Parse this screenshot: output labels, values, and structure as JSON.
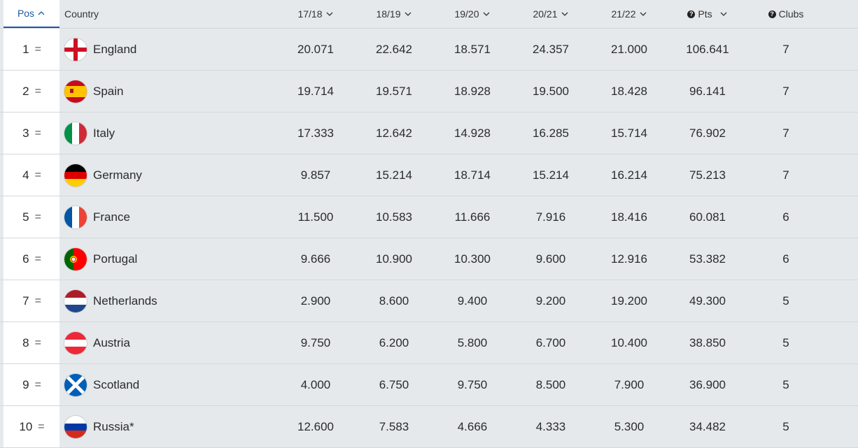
{
  "header": {
    "pos": "Pos",
    "country": "Country",
    "seasons": [
      "17/18",
      "18/19",
      "19/20",
      "20/21",
      "21/22"
    ],
    "pts": "Pts",
    "clubs": "Clubs"
  },
  "rows": [
    {
      "pos": "1",
      "trend": "=",
      "country": "England",
      "flag": "england-flag-icon",
      "s": [
        "20.071",
        "22.642",
        "18.571",
        "24.357",
        "21.000"
      ],
      "pts": "106.641",
      "clubs": "7"
    },
    {
      "pos": "2",
      "trend": "=",
      "country": "Spain",
      "flag": "spain-flag-icon",
      "s": [
        "19.714",
        "19.571",
        "18.928",
        "19.500",
        "18.428"
      ],
      "pts": "96.141",
      "clubs": "7"
    },
    {
      "pos": "3",
      "trend": "=",
      "country": "Italy",
      "flag": "italy-flag-icon",
      "s": [
        "17.333",
        "12.642",
        "14.928",
        "16.285",
        "15.714"
      ],
      "pts": "76.902",
      "clubs": "7"
    },
    {
      "pos": "4",
      "trend": "=",
      "country": "Germany",
      "flag": "germany-flag-icon",
      "s": [
        "9.857",
        "15.214",
        "18.714",
        "15.214",
        "16.214"
      ],
      "pts": "75.213",
      "clubs": "7"
    },
    {
      "pos": "5",
      "trend": "=",
      "country": "France",
      "flag": "france-flag-icon",
      "s": [
        "11.500",
        "10.583",
        "11.666",
        "7.916",
        "18.416"
      ],
      "pts": "60.081",
      "clubs": "6"
    },
    {
      "pos": "6",
      "trend": "=",
      "country": "Portugal",
      "flag": "portugal-flag-icon",
      "s": [
        "9.666",
        "10.900",
        "10.300",
        "9.600",
        "12.916"
      ],
      "pts": "53.382",
      "clubs": "6"
    },
    {
      "pos": "7",
      "trend": "=",
      "country": "Netherlands",
      "flag": "netherlands-flag-icon",
      "s": [
        "2.900",
        "8.600",
        "9.400",
        "9.200",
        "19.200"
      ],
      "pts": "49.300",
      "clubs": "5"
    },
    {
      "pos": "8",
      "trend": "=",
      "country": "Austria",
      "flag": "austria-flag-icon",
      "s": [
        "9.750",
        "6.200",
        "5.800",
        "6.700",
        "10.400"
      ],
      "pts": "38.850",
      "clubs": "5"
    },
    {
      "pos": "9",
      "trend": "=",
      "country": "Scotland",
      "flag": "scotland-flag-icon",
      "s": [
        "4.000",
        "6.750",
        "9.750",
        "8.500",
        "7.900"
      ],
      "pts": "36.900",
      "clubs": "5"
    },
    {
      "pos": "10",
      "trend": "=",
      "country": "Russia*",
      "flag": "russia-flag-icon",
      "s": [
        "12.600",
        "7.583",
        "4.666",
        "4.333",
        "5.300"
      ],
      "pts": "34.482",
      "clubs": "5"
    }
  ],
  "colors": {
    "accent": "#1a5aa6",
    "background": "#e5e9ec"
  }
}
